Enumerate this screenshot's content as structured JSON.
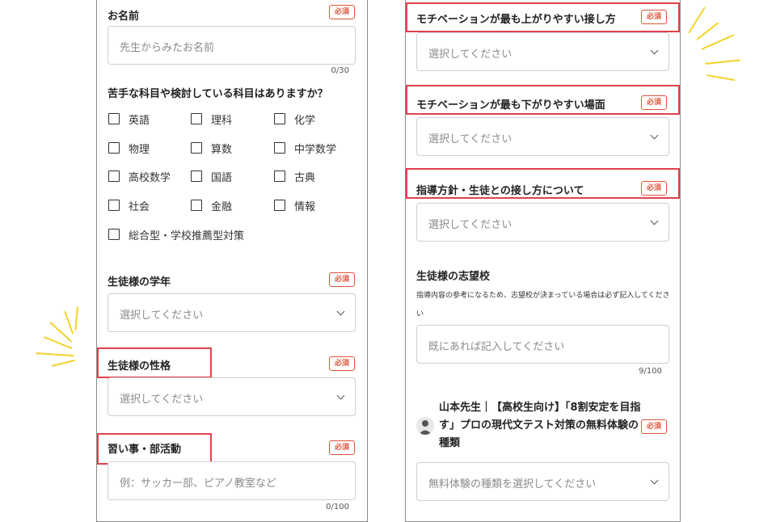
{
  "required_badge": "必須",
  "left": {
    "name": {
      "label": "お名前",
      "placeholder": "先生からみたお名前",
      "counter": "0/30"
    },
    "subjects": {
      "question": "苦手な科目や検討している科目はありますか？",
      "options": [
        "英語",
        "理科",
        "化学",
        "物理",
        "算数",
        "中学数学",
        "高校数学",
        "国語",
        "古典",
        "社会",
        "金融",
        "情報",
        "総合型・学校推薦型対策"
      ]
    },
    "grade": {
      "label": "生徒様の学年",
      "value": "選択してください"
    },
    "personality": {
      "label": "生徒様の性格",
      "value": "選択してください"
    },
    "activities": {
      "label": "習い事・部活動",
      "placeholder": "例：サッカー部、ピアノ教室など",
      "counter": "0/100"
    }
  },
  "right": {
    "motivation_up": {
      "label": "モチベーションが最も上がりやすい接し方",
      "value": "選択してください"
    },
    "motivation_down": {
      "label": "モチベーションが最も下がりやすい場面",
      "value": "選択してください"
    },
    "policy": {
      "label": "指導方針・生徒との接し方について",
      "value": "選択してください"
    },
    "school": {
      "label": "生徒様の志望校",
      "helper": "指導内容の参考になるため、志望校が決まっている場合は必ず記入してください",
      "placeholder": "既にあれば記入してください",
      "counter": "9/100"
    },
    "trial": {
      "label": "山本先生｜【高校生向け】「8割安定を目指す」プロの現代文テスト対策の無料体験の種類",
      "value": "無料体験の種類を選択してください"
    }
  },
  "colors": {
    "required": "#e0553c",
    "highlight": "#e0414b",
    "accent_rays": "#f3d22b",
    "panel_border": "#8c8c8c"
  }
}
